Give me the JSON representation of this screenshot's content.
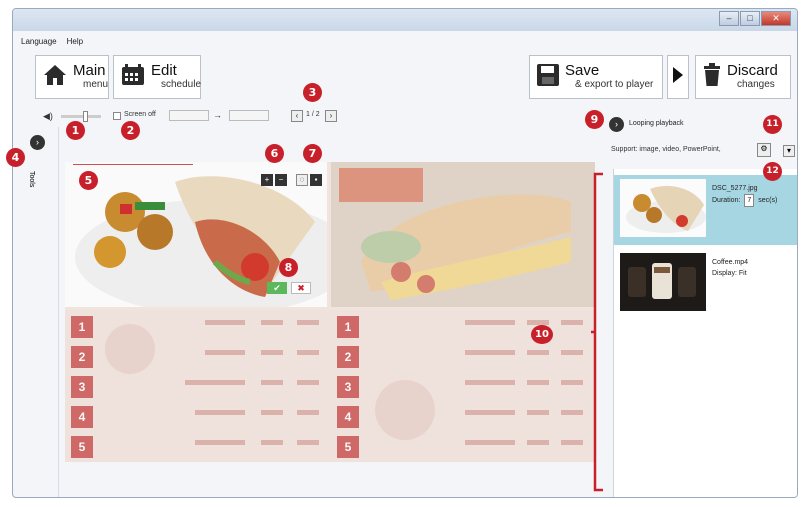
{
  "menu": {
    "items": [
      "Language",
      "Help"
    ]
  },
  "window_buttons": [
    "–",
    "□",
    "✕"
  ],
  "toolbar": {
    "main": {
      "title": "Main",
      "subtitle": "menu",
      "icon": "home-icon"
    },
    "edit": {
      "title": "Edit",
      "subtitle": "schedule",
      "icon": "calendar-icon"
    },
    "save": {
      "title": "Save",
      "subtitle": "& export to player",
      "icon": "floppy-icon"
    },
    "next": {
      "icon": "play-arrow-icon"
    },
    "discard": {
      "title": "Discard",
      "subtitle": "changes",
      "icon": "trash-icon"
    }
  },
  "subbar": {
    "screen_off_label": "Screen off",
    "page_indicator": "1 / 2",
    "arrow": "→"
  },
  "tools_label": "Tools",
  "playback": {
    "label": "Looping playback"
  },
  "support": {
    "label": "Support:  image, video, PowerPoint,"
  },
  "playlist": [
    {
      "name": "DSC_5277.jpg",
      "detail_label": "Duration:",
      "detail_value": "7",
      "detail_unit": "sec(s)"
    },
    {
      "name": "Coffee.mp4",
      "detail_label": "Display:",
      "detail_value": "Fit",
      "detail_unit": ""
    }
  ],
  "callouts": [
    "1",
    "2",
    "3",
    "4",
    "5",
    "6",
    "7",
    "8",
    "9",
    "10",
    "11",
    "12"
  ],
  "menu_numbers": [
    "1",
    "2",
    "3",
    "4",
    "5"
  ],
  "colors": {
    "callout": "#c8202a",
    "accent_red": "#c44242",
    "selected_row": "#a7d6e3"
  }
}
